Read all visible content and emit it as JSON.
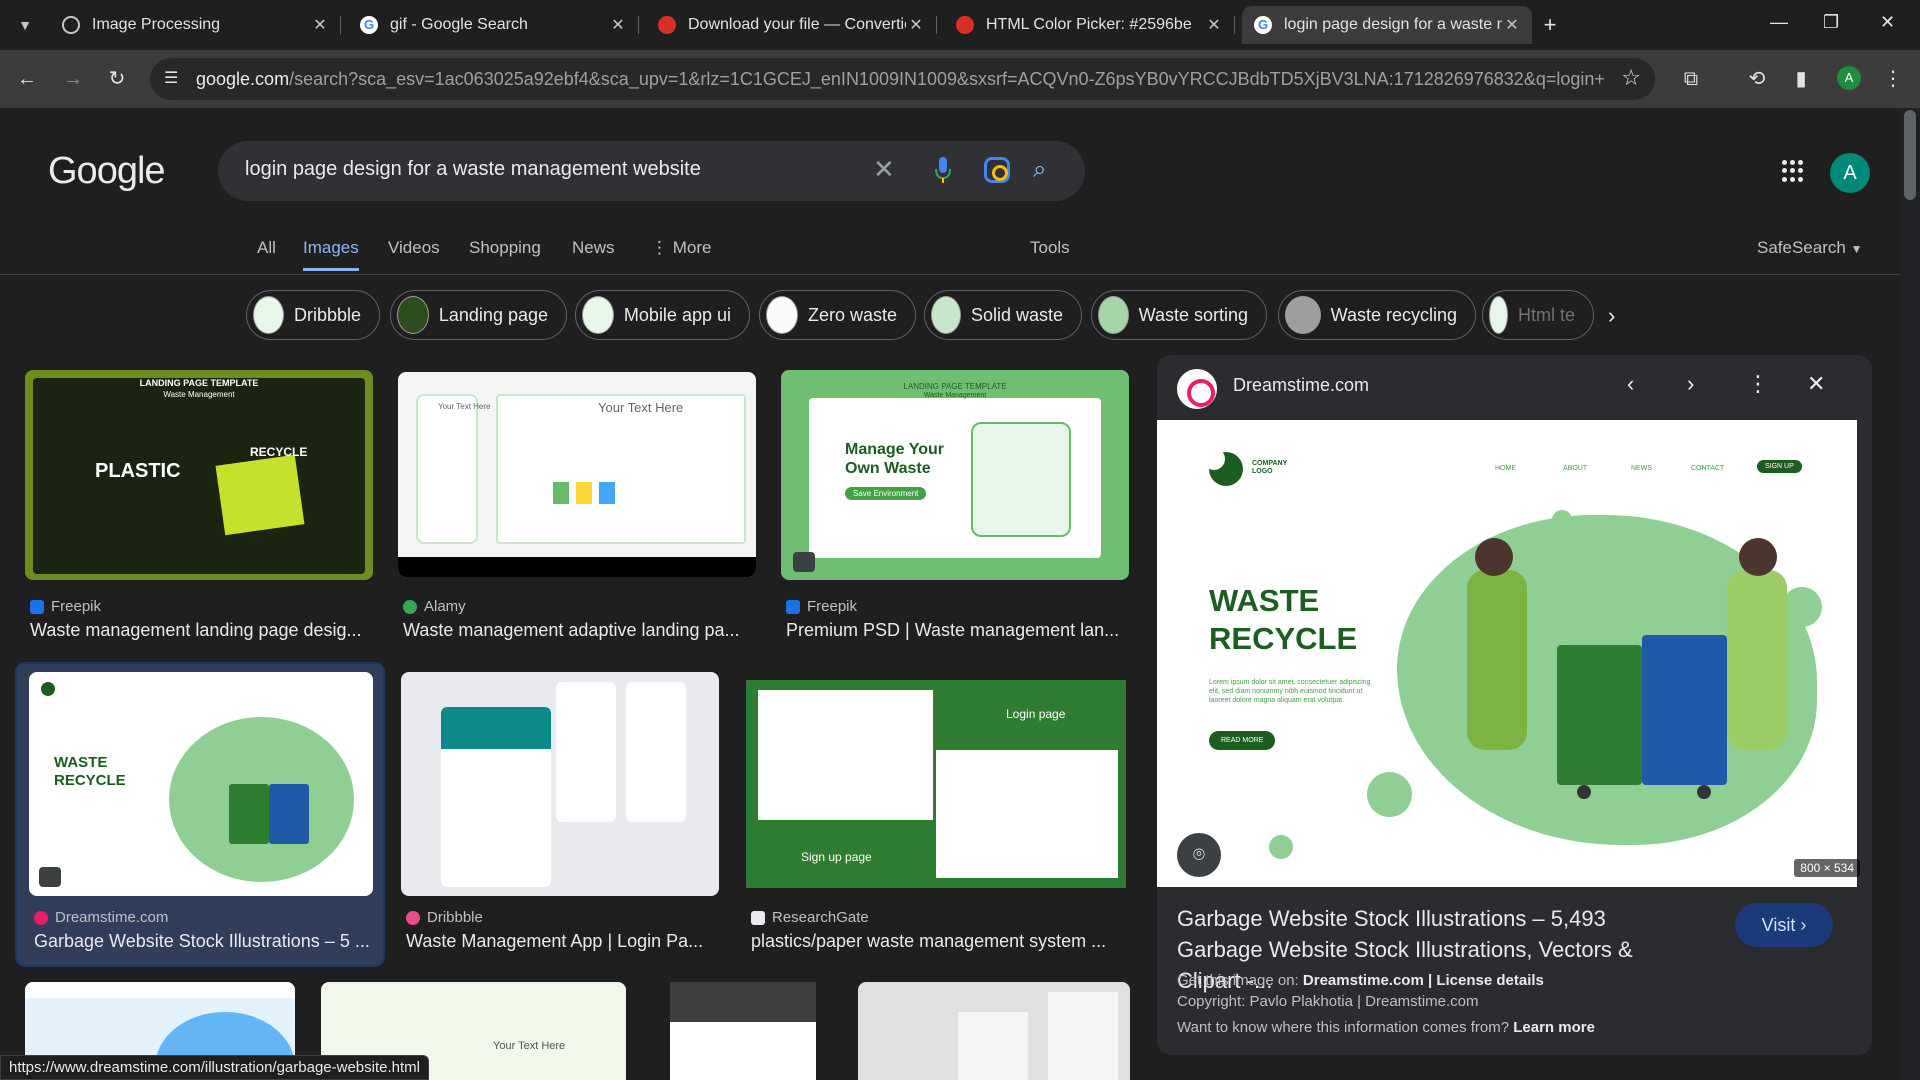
{
  "browser": {
    "tabs": [
      {
        "title": "Image Processing",
        "favicon": "globe-icon"
      },
      {
        "title": "gif - Google Search",
        "favicon": "google-icon"
      },
      {
        "title": "Download your file — Convertio",
        "favicon": "convertio-icon"
      },
      {
        "title": "HTML Color Picker: #2596be",
        "favicon": "colorpicker-icon"
      },
      {
        "title": "login page design for a waste management website",
        "favicon": "google-icon"
      }
    ],
    "active_tab_index": 4,
    "url_domain": "google.com",
    "url_rest": "/search?sca_esv=1ac063025a92ebf4&sca_upv=1&rlz=1C1GCEJ_enIN1009IN1009&sxsrf=ACQVn0-Z6psYB0vYRCCJBdbTD5XjBV3LNA:1712826976832&q=login+page+des...",
    "profile_initial": "A"
  },
  "google": {
    "logo": "Google",
    "query": "login page design for a waste management website",
    "avatar_initial": "A",
    "nav": [
      "All",
      "Images",
      "Videos",
      "Shopping",
      "News",
      "More"
    ],
    "nav_selected": "Images",
    "tools": "Tools",
    "safesearch": "SafeSearch"
  },
  "chips": [
    "Dribbble",
    "Landing page",
    "Mobile app ui",
    "Zero waste",
    "Solid waste",
    "Waste sorting",
    "Waste recycling",
    "Html te"
  ],
  "results": [
    {
      "source": "Freepik",
      "title": "Waste management landing page desig...",
      "img_heading": "LANDING PAGE TEMPLATE",
      "img_sub": "Waste Management",
      "img_text": "PLASTIC",
      "img_text2": "RECYCLE"
    },
    {
      "source": "Alamy",
      "title": "Waste management adaptive landing pa...",
      "img_text": "Your Text Here",
      "img_text2": "Your Text Here"
    },
    {
      "source": "Freepik",
      "title": "Premium PSD | Waste management lan...",
      "img_heading": "LANDING PAGE TEMPLATE",
      "img_sub": "Waste Management",
      "img_text": "Manage Your Own Waste",
      "img_btn": "Save Environment"
    },
    {
      "source": "Dreamstime.com",
      "title": "Garbage Website Stock Illustrations – 5 ...",
      "img_text": "WASTE RECYCLE"
    },
    {
      "source": "Dribbble",
      "title": "Waste Management App | Login Pa..."
    },
    {
      "source": "ResearchGate",
      "title": "plastics/paper waste management system ...",
      "img_text": "Login page",
      "img_text2": "Sign up page"
    }
  ],
  "bottom_row_text": "Your Text Here",
  "panel": {
    "site": "Dreamstime.com",
    "preview": {
      "company": "COMPANY LOGO",
      "nav": [
        "HOME",
        "ABOUT",
        "NEWS",
        "CONTACT"
      ],
      "signup": "SIGN UP",
      "headline1": "WASTE",
      "headline2": "RECYCLE",
      "body": "Lorem ipsum dolor sit amet, consectetuer adipiscing elit, sed diam nonummy nibh euismod tincidunt ut laoreet dolore magna aliquam erat volutpat.",
      "cta": "READ MORE"
    },
    "dims": "800 × 534",
    "title": "Garbage Website Stock Illustrations – 5,493 Garbage Website Stock Illustrations, Vectors & Clipart -...",
    "visit": "Visit",
    "get_image_label": "Get this image on:",
    "get_image_site": "Dreamstime.com",
    "separator": "|",
    "license": "License details",
    "copyright": "Copyright: Pavlo Plakhotia | Dreamstime.com",
    "want_to_know": "Want to know where this information comes from?",
    "learn_more": "Learn more"
  },
  "status_url": "https://www.dreamstime.com/illustration/garbage-website.html",
  "colors": {
    "accent": "#8ab4f8",
    "green": "#2e7d32",
    "bg": "#1f1f1f"
  }
}
